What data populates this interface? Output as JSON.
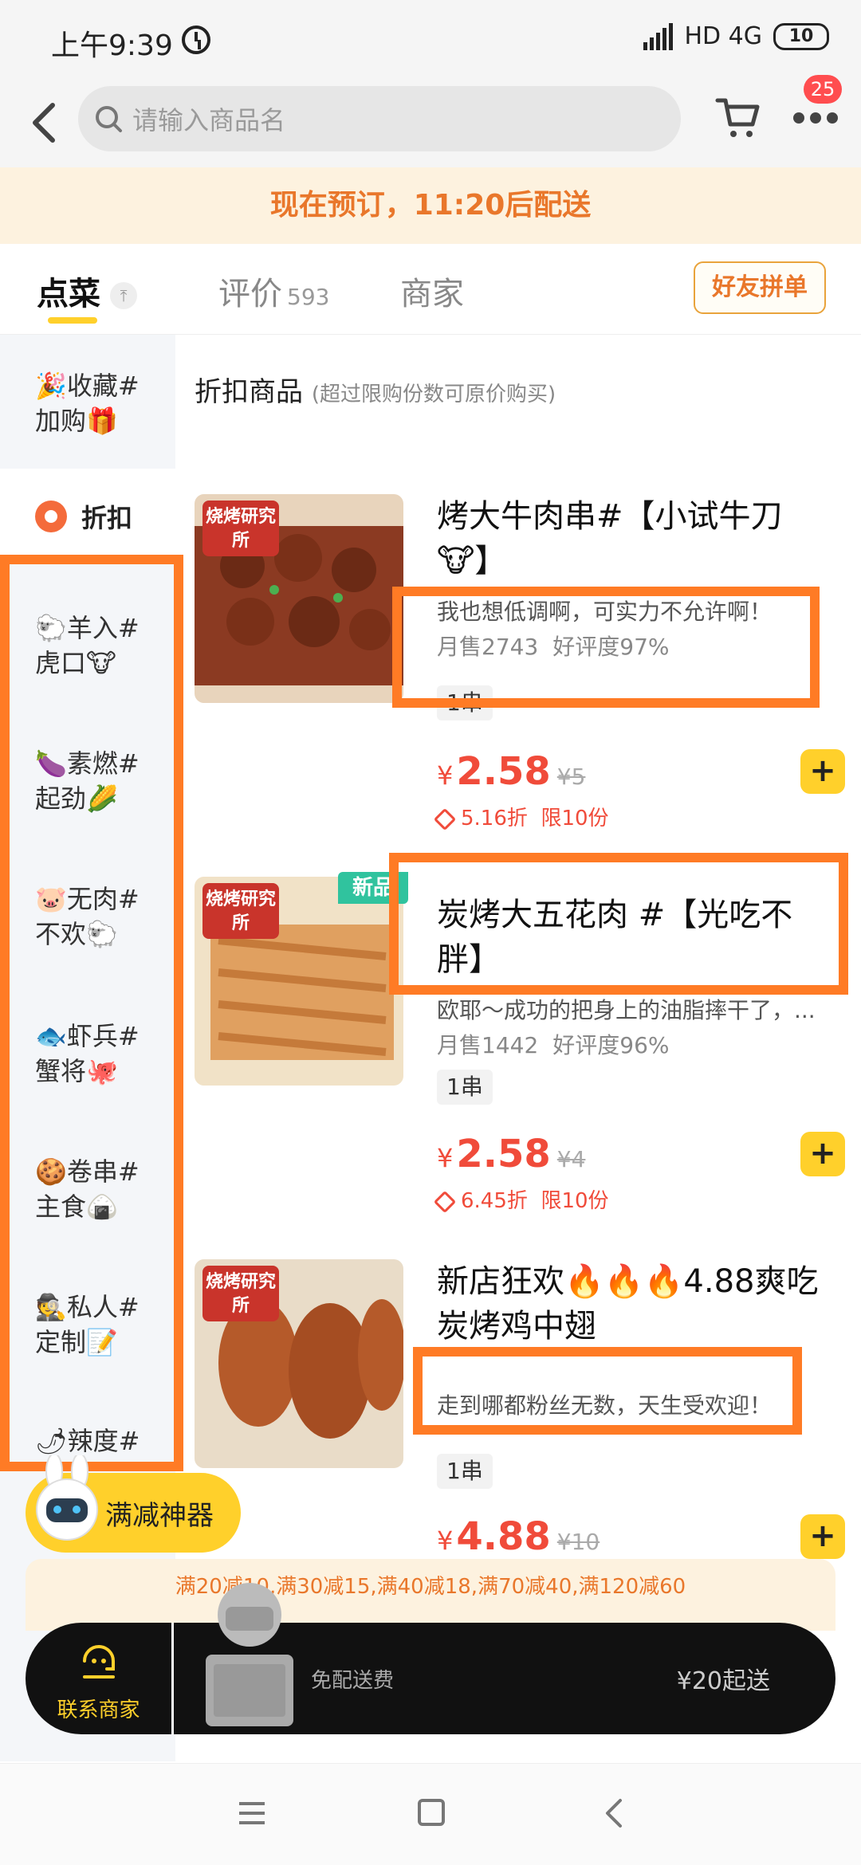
{
  "status": {
    "time": "上午9:39",
    "network": "HD 4G",
    "battery": "10"
  },
  "nav": {
    "search_placeholder": "请输入商品名",
    "badge_count": "25"
  },
  "banner": {
    "text": "现在预订，11:20后配送"
  },
  "tabs": [
    {
      "label": "点菜"
    },
    {
      "label": "评价",
      "count": "593"
    },
    {
      "label": "商家"
    }
  ],
  "friend_button": "好友拼单",
  "sidebar": {
    "favorites": [
      "🎉收藏#",
      "加购🎁"
    ],
    "discount": "折扣",
    "items": [
      [
        "🐑羊入#",
        "虎口🐮"
      ],
      [
        "🍆素燃#",
        "起劲🌽"
      ],
      [
        "🐷无肉#",
        "不欢🐑"
      ],
      [
        "🐟虾兵#",
        "蟹将🐙"
      ],
      [
        "🍪卷串#",
        "主食🍙"
      ],
      [
        "🕵私人#",
        "定制📝"
      ],
      [
        "🌶辣度#",
        ""
      ]
    ]
  },
  "section": {
    "title": "折扣商品",
    "subtitle": "(超过限购份数可原价购买)"
  },
  "products": [
    {
      "shop_tag": "烧烤研究所",
      "name": "烤大牛肉串#【小试牛刀🐮】",
      "desc": "我也想低调啊，可实力不允许啊！",
      "sales": "月售2743",
      "rating": "好评度97%",
      "spec": "1串",
      "price": "2.58",
      "original_price": "¥5",
      "discount": "5.16折",
      "limit": "限10份"
    },
    {
      "shop_tag": "烧烤研究所",
      "new_tag": "新品",
      "name": "炭烤大五花肉 #【光吃不胖】",
      "desc": "欧耶～成功的把身上的油脂摔干了，...",
      "sales": "月售1442",
      "rating": "好评度96%",
      "spec": "1串",
      "price": "2.58",
      "original_price": "¥4",
      "discount": "6.45折",
      "limit": "限10份"
    },
    {
      "shop_tag": "烧烤研究所",
      "name": "新店狂欢🔥🔥🔥4.88爽吃炭烤鸡中翅",
      "desc": "走到哪都粉丝无数，天生受欢迎！",
      "spec": "1串",
      "price": "4.88",
      "original_price": "¥10"
    }
  ],
  "manjian": "满减神器",
  "promo_bar": "满20减10,满30减15,满40减18,满70减40,满120减60",
  "bottom": {
    "contact": "联系商家",
    "free_delivery": "免配送费",
    "min_order": "¥20起送"
  },
  "colors": {
    "accent": "#ffd02b",
    "highlight": "#ff7b25",
    "price": "#f04b3a",
    "banner_text": "#e9772b"
  }
}
